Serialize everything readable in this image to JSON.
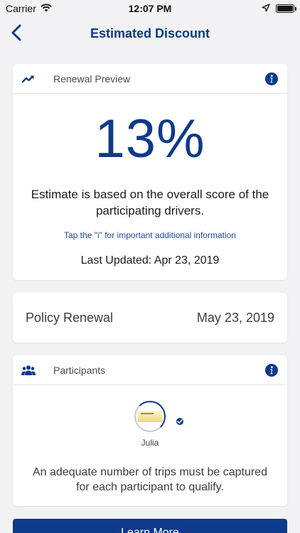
{
  "status_bar": {
    "carrier": "Carrier",
    "time": "12:07 PM"
  },
  "nav": {
    "title": "Estimated Discount"
  },
  "renewal_preview": {
    "header": "Renewal Preview",
    "percent": "13%",
    "estimate_text": "Estimate is based on the overall score of the participating drivers.",
    "tap_info": "Tap the \"i\" for important additional information",
    "last_updated": "Last Updated: Apr 23, 2019"
  },
  "policy": {
    "label": "Policy Renewal",
    "date": "May 23, 2019"
  },
  "participants": {
    "header": "Participants",
    "items": [
      {
        "name": "Julia"
      }
    ],
    "note": "An adequate number of trips must be captured for each participant to qualify."
  },
  "bottom_button": {
    "label": "Learn More"
  },
  "colors": {
    "brand_blue": "#0d3a8a",
    "background": "#f2f2f4",
    "card": "#ffffff"
  },
  "icons": {
    "trend": "trend-up-icon",
    "info": "info-icon",
    "people": "people-icon",
    "back": "chevron-left-icon",
    "wifi": "wifi-icon",
    "location": "location-arrow-icon",
    "battery": "battery-icon",
    "check": "check-badge-icon"
  }
}
